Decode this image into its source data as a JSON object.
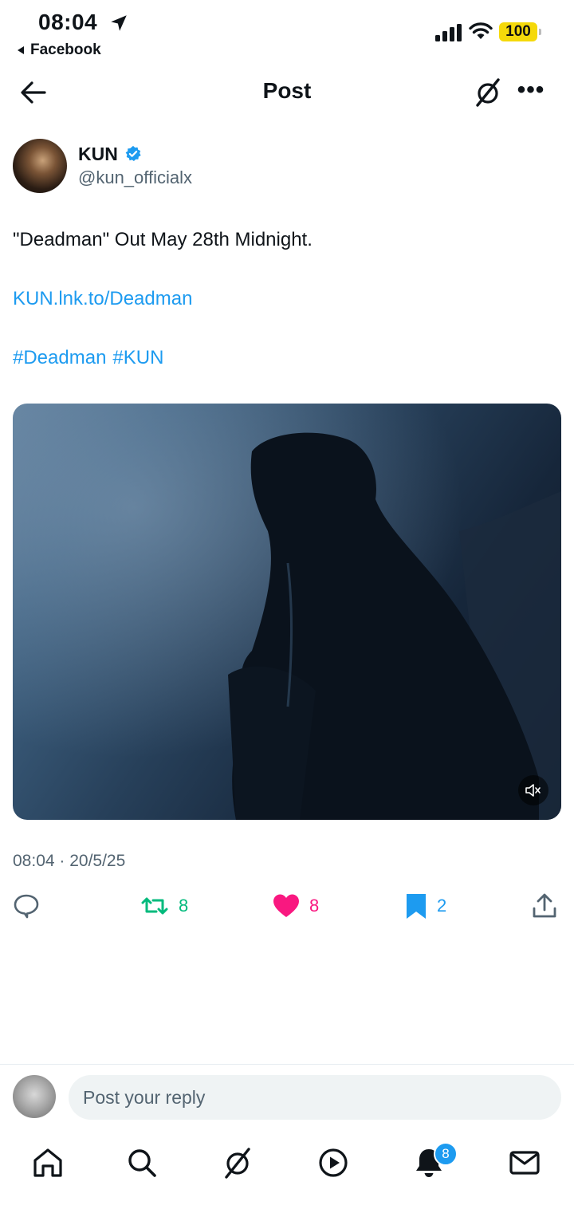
{
  "status_bar": {
    "time": "08:04",
    "back_app": "Facebook",
    "battery": "100",
    "battery_color": "#f5d90a"
  },
  "header": {
    "title": "Post"
  },
  "post": {
    "author_name": "KUN",
    "author_handle": "@kun_officialx",
    "verified": true,
    "text": "\"Deadman\" Out May 28th Midnight.",
    "link": "KUN.lnk.to/Deadman",
    "hashtags": [
      "#Deadman",
      "#KUN"
    ],
    "media_type": "video",
    "timestamp": "08:04 · 20/5/25"
  },
  "actions": {
    "reply_count": "",
    "retweet_count": "8",
    "like_count": "8",
    "bookmark_count": "2"
  },
  "reply_bar": {
    "placeholder": "Post your reply"
  },
  "bottom_nav": {
    "items": [
      "home-icon",
      "search-icon",
      "grok-icon",
      "video-icon",
      "notifications-icon",
      "messages-icon"
    ],
    "notifications_badge": "8"
  },
  "colors": {
    "accent": "#1d9bf0",
    "retweet": "#00ba7c",
    "like": "#f91880",
    "secondary_text": "#536471"
  }
}
